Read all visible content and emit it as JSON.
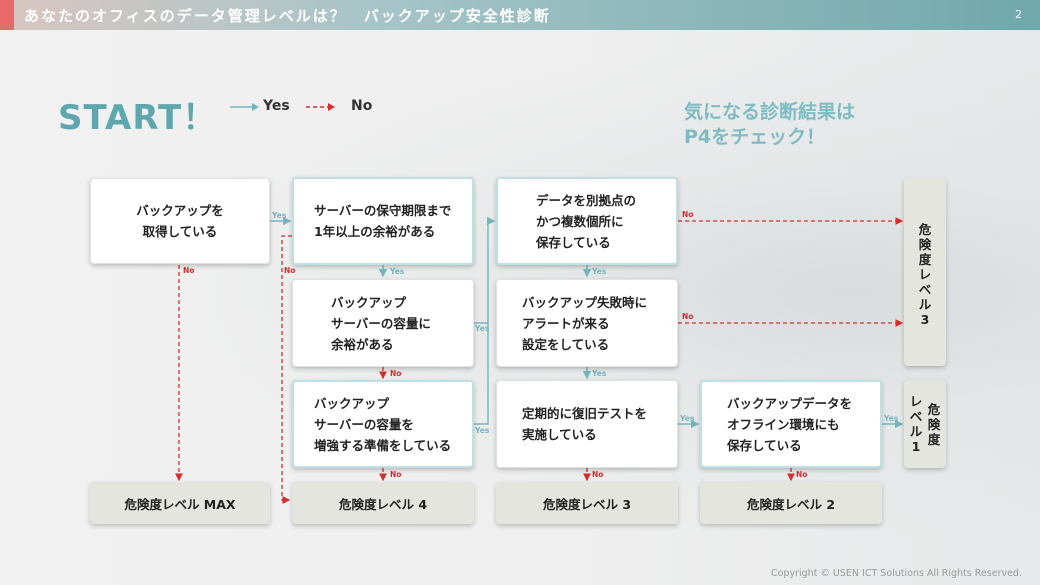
{
  "header": {
    "title": "あなたのオフィスのデータ管理レベルは？　バックアップ安全性診断",
    "page_number": "2"
  },
  "start_label": "START！",
  "legend": {
    "yes": "Yes",
    "no": "No"
  },
  "note": {
    "line1": "気になる診断結果は",
    "line2": "P4をチェック！"
  },
  "questions": [
    {
      "id": "q1",
      "lines": [
        "バックアップを",
        "取得している"
      ]
    },
    {
      "id": "q2",
      "lines": [
        "サーバーの保守期限まで",
        "1年以上の余裕がある"
      ]
    },
    {
      "id": "q3",
      "lines": [
        "バックアップ",
        "サーバーの容量に",
        "余裕がある"
      ]
    },
    {
      "id": "q4",
      "lines": [
        "バックアップ",
        "サーバーの容量を",
        "増強する準備をしている"
      ]
    },
    {
      "id": "q5",
      "lines": [
        "データを別拠点の",
        "かつ複数個所に",
        "保存している"
      ]
    },
    {
      "id": "q6",
      "lines": [
        "バックアップ失敗時に",
        "アラートが来る",
        "設定をしている"
      ]
    },
    {
      "id": "q7",
      "lines": [
        "定期的に復旧テストを",
        "実施している"
      ]
    },
    {
      "id": "q8",
      "lines": [
        "バックアップデータを",
        "オフライン環境にも",
        "保存している"
      ]
    }
  ],
  "outcomes": {
    "max": "危険度レベル MAX",
    "level4": "危険度レベル 4",
    "level3": "危険度レベル 3",
    "level2": "危険度レベル 2",
    "level3_side": [
      "危",
      "険",
      "度",
      "レ",
      "ベ",
      "ル",
      "3"
    ],
    "level1_side": {
      "col_right": [
        "危",
        "険",
        "度"
      ],
      "col_left": [
        "レ",
        "ベ",
        "ル",
        "1"
      ]
    }
  },
  "edge_labels": {
    "yes": "Yes",
    "no": "No"
  },
  "colors": {
    "yes_arrow": "#74b6bd",
    "no_arrow": "#d62c2c",
    "accent": "#5fa7ae",
    "header_mark": "#e86a6a"
  },
  "copyright": "Copyright © USEN ICT Solutions All Rights Reserved."
}
